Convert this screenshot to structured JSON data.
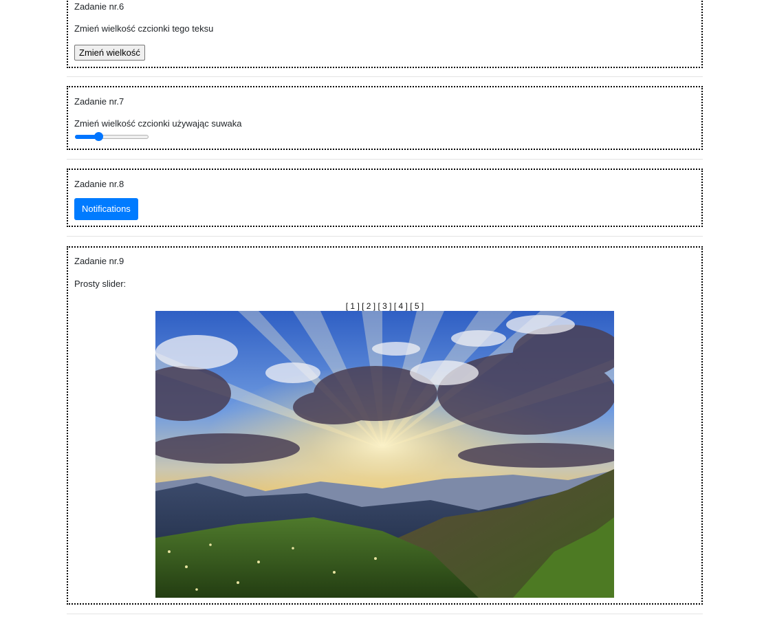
{
  "task6": {
    "title": "Zadanie nr.6",
    "description": "Zmień wielkość czcionki tego teksu",
    "button_label": "Zmień wielkość"
  },
  "task7": {
    "title": "Zadanie nr.7",
    "description": "Zmień wielkość czcionki używając suwaka",
    "slider_value_fraction": 0.3
  },
  "task8": {
    "title": "Zadanie nr.8",
    "button_label": "Notifications"
  },
  "task9": {
    "title": "Zadanie nr.9",
    "description": "Prosty slider:",
    "nav": [
      "[ 1 ]",
      "[ 2 ]",
      "[ 3 ]",
      "[ 4 ]",
      "[ 5 ]"
    ],
    "image_icon": "mountain-sunset-image"
  },
  "colors": {
    "accent": "#007bff",
    "slider_accent": "#0075ff",
    "border": "#000000",
    "divider": "#e3e3e3"
  }
}
